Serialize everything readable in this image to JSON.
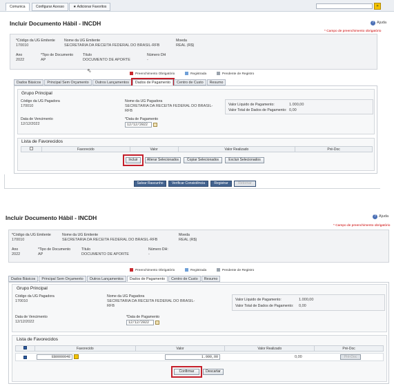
{
  "topnav": {
    "tabs": [
      "Comunica",
      "Configurar Acesso",
      "Adicionar Favoritos"
    ]
  },
  "screen1": {
    "title": "Incluir Documento Hábil - INCDH",
    "help": "Ajuda",
    "required_note": "* Campo de preenchimento obrigatório",
    "header": {
      "ug_code_label": "*Código da UG Emitente",
      "ug_code": "170010",
      "ug_name_label": "Nome da UG Emitente",
      "ug_name": "SECRETARIA DA RECEITA FEDERAL DO BRASIL-RFB",
      "currency_label": "Moeda",
      "currency": "REAL (R$)",
      "year_label": "Ano",
      "year": "2022",
      "doctype_label": "*Tipo de Documento",
      "doctype": "AP",
      "doctitle_label": "Título",
      "doctitle": "DOCUMENTO DE APORTE",
      "dh_label": "Número DH",
      "dh": "-"
    },
    "legend": {
      "required": "Preenchimento Obrigatório",
      "registered": "Registrada",
      "pending": "Pendente de Registro"
    },
    "tabs": [
      "Dados Básicos",
      "Principal Sem Orçamento",
      "Outros Lançamentos",
      "Dados de Pagamento",
      "Centro de Custo",
      "Resumo"
    ],
    "group_title": "Grupo Principal",
    "payer_code_label": "Código da UG Pagadora",
    "payer_code": "170010",
    "payer_name_label": "Nome da UG Pagadora",
    "payer_name_1": "SECRETARIA DA RECEITA FEDERAL DO BRASIL-",
    "payer_name_2": "RFB",
    "net_label": "Valor Líquido de Pagamento:",
    "net_value": "1.000,00",
    "total_label": "Valor Total de Dados de Pagamento:",
    "total_value": "0,00",
    "due_label": "Data de Vencimento",
    "due_value": "12/12/2022",
    "paydate_label": "*Data de Pagamento",
    "paydate_value": "12/12/2022",
    "list_title": "Lista de Favorecidos",
    "columns": [
      "Favorecido",
      "Valor",
      "Valor Realizado",
      "Pré-Doc"
    ],
    "buttons": {
      "include": "Incluir",
      "alter": "Alterar Selecionados",
      "copy": "Copiar Selecionados",
      "delete": "Excluir Selecionados"
    },
    "footer_buttons": {
      "draft": "Salvar Rascunho",
      "check": "Verificar Consistência",
      "register": "Registrar",
      "return": "Retornar"
    }
  },
  "screen2": {
    "title": "Incluir Documento Hábil - INCDH",
    "help": "Ajuda",
    "required_note": "* Campo de preenchimento obrigatório",
    "header": {
      "ug_code_label": "*Código da UG Emitente",
      "ug_code": "170010",
      "ug_name_label": "Nome da UG Emitente",
      "ug_name": "SECRETARIA DA RECEITA FEDERAL DO BRASIL-RFB",
      "currency_label": "Moeda",
      "currency": "REAL (R$)",
      "year_label": "Ano",
      "year": "2022",
      "doctype_label": "*Tipo de Documento",
      "doctype": "AP",
      "doctitle_label": "Título",
      "doctitle": "DOCUMENTO DE APORTE",
      "dh_label": "Número DH:",
      "dh": "-"
    },
    "legend": {
      "required": "Preenchimento Obrigatório",
      "registered": "Registrada",
      "pending": "Pendente de Registro"
    },
    "tabs": [
      "Dados Básicos",
      "Principal Sem Orçamento",
      "Outros Lançamentos",
      "Dados de Pagamento",
      "Centro de Custo",
      "Resumo"
    ],
    "group_title": "Grupo Principal",
    "payer_code_label": "Código da UG Pagadora",
    "payer_code": "170010",
    "payer_name_label": "Nome da UG Pagadora",
    "payer_name_1": "SECRETARIA DA RECEITA FEDERAL DO BRASIL-",
    "payer_name_2": "RFB",
    "net_label": "Valor Líquido de Pagamento:",
    "net_value": "1.000,00",
    "total_label": "Valor Total de Dados de Pagamento:",
    "total_value": "0,00",
    "due_label": "Data de Vencimento",
    "due_value": "12/12/2022",
    "paydate_label": "*Data de Pagamento",
    "paydate_value": "12/12/2022",
    "list_title": "Lista de Favorecidos",
    "columns": [
      "Favorecido",
      "Valor",
      "Valor Realizado",
      "Pré-Doc"
    ],
    "row": {
      "favorecido": "EB0000048",
      "valor": "1.000,00",
      "realizado": "0,00",
      "predoc": "Pré-Doc"
    },
    "buttons": {
      "confirm": "Confirmar",
      "discard": "Descartar"
    }
  }
}
